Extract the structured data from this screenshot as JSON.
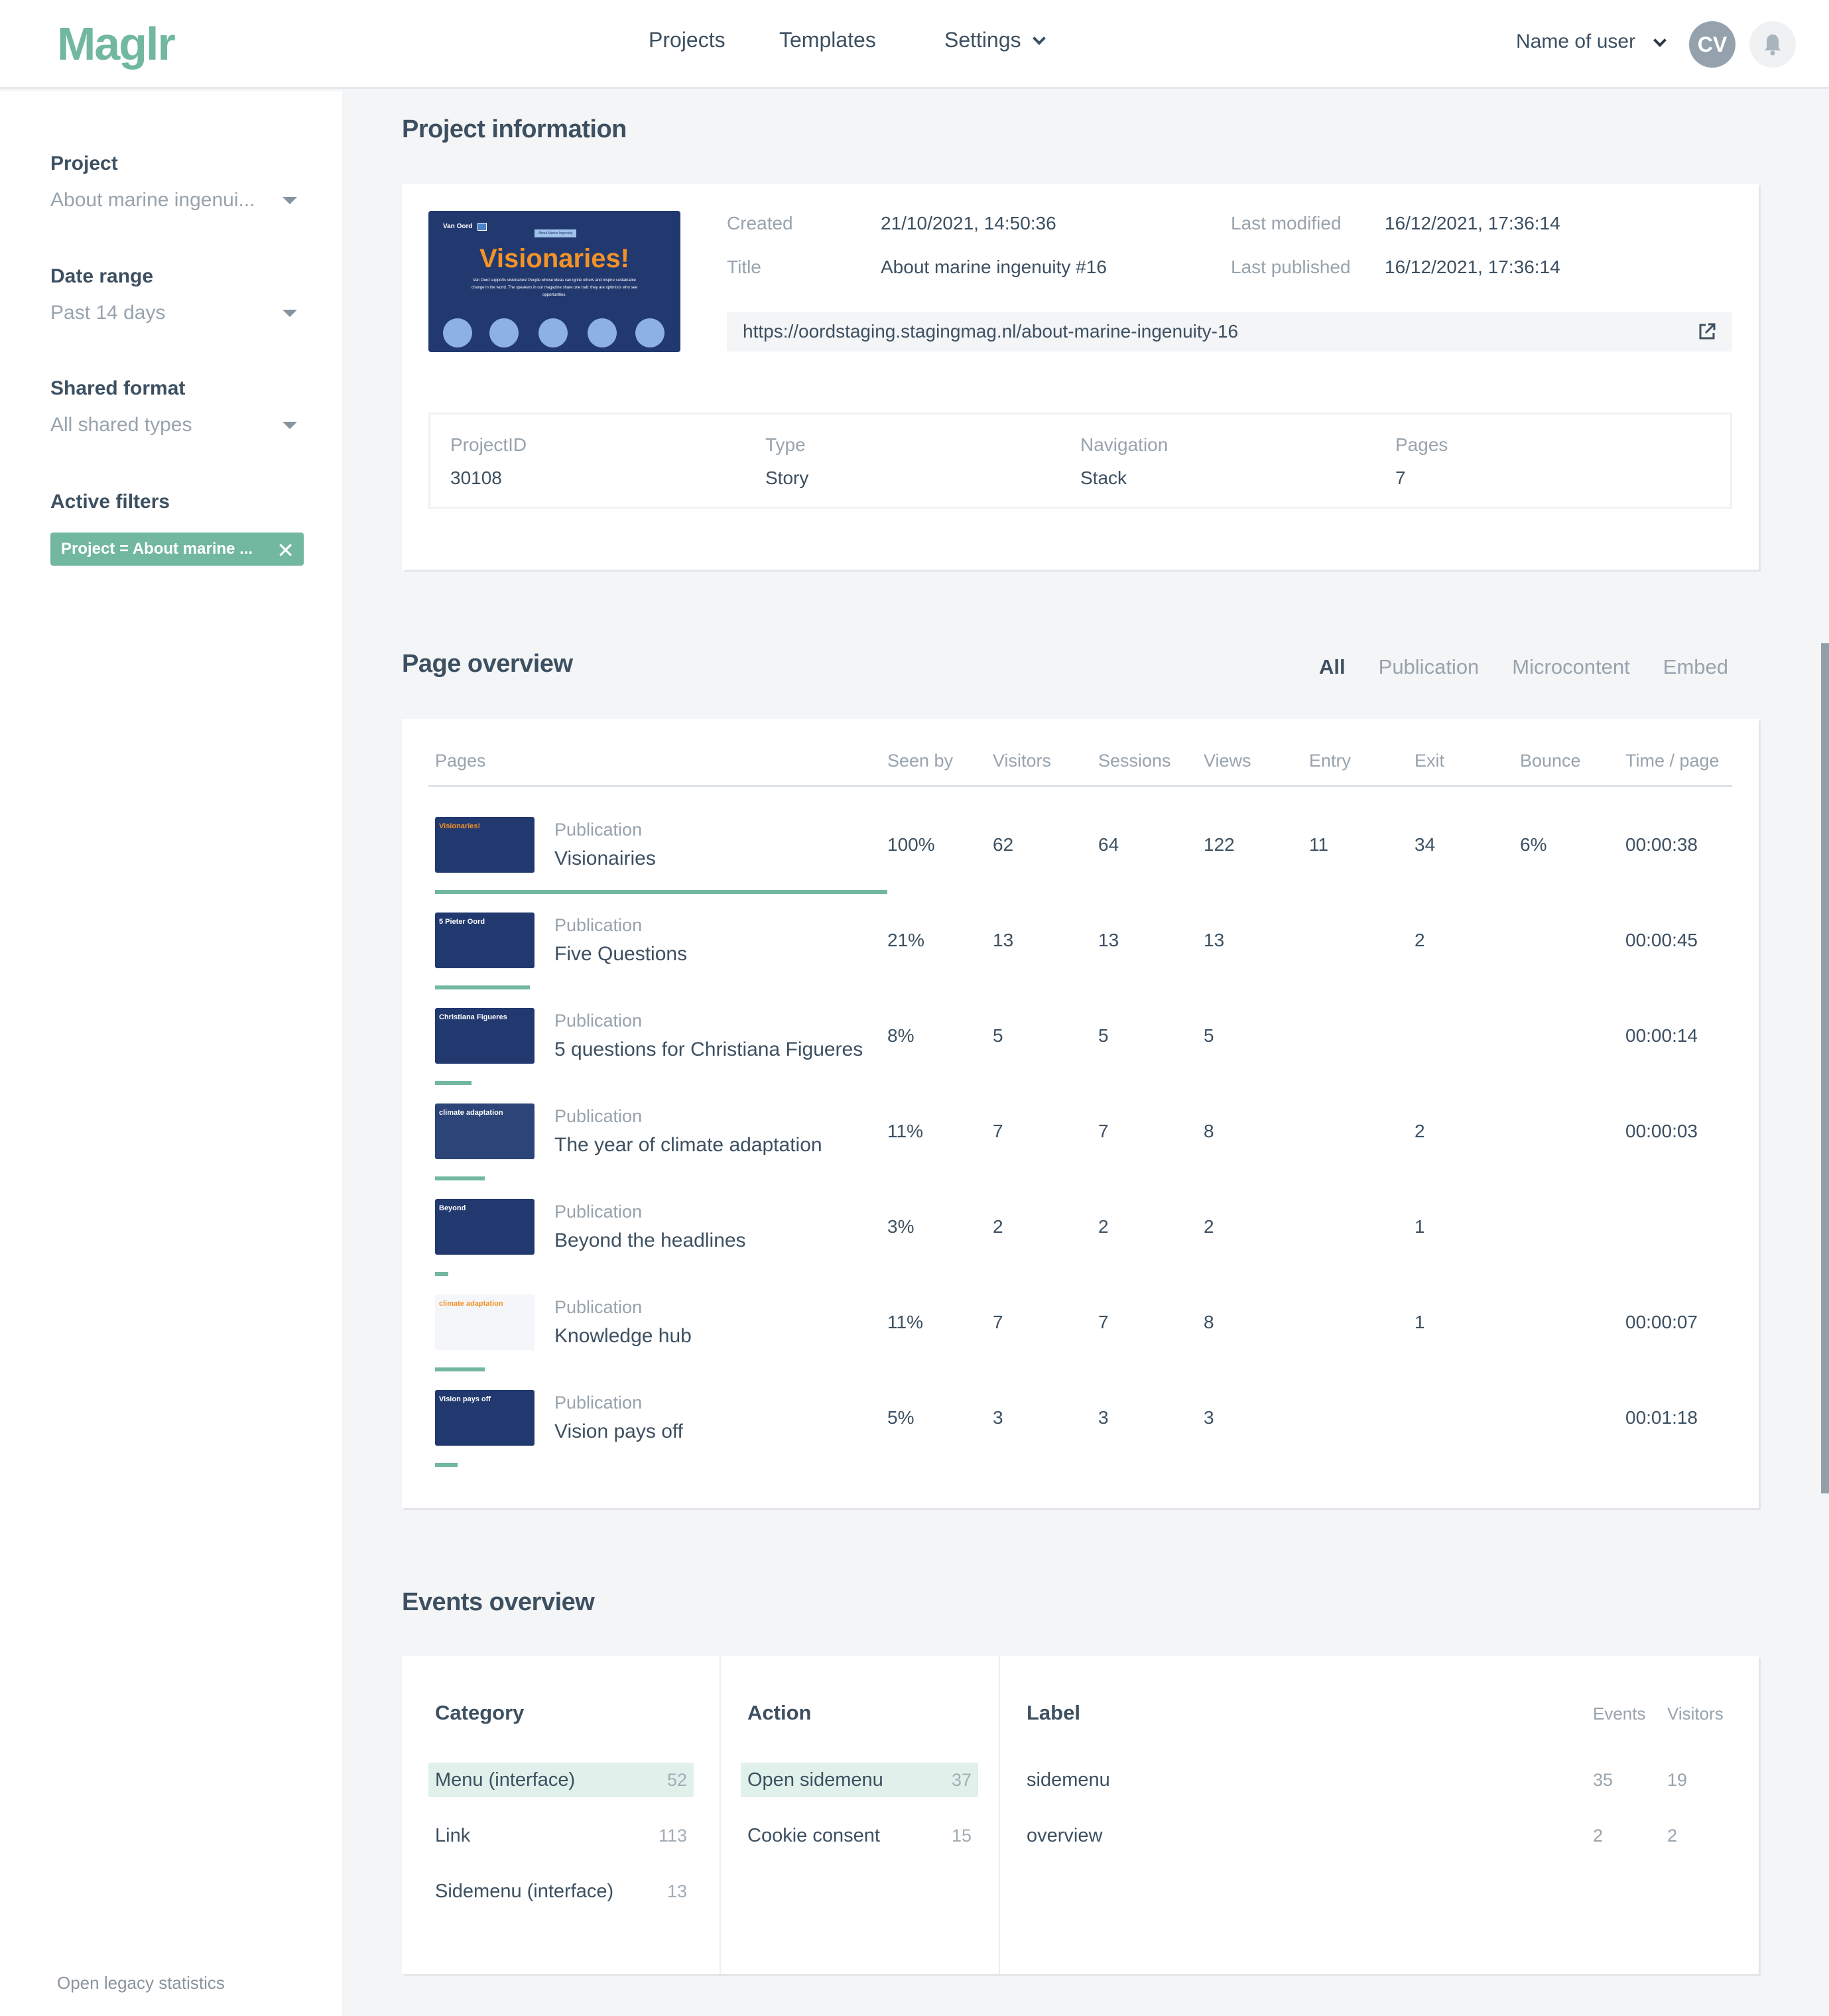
{
  "brand": {
    "logo": "Maglr",
    "accent_color": "#72b7a0"
  },
  "nav": {
    "items": [
      "Projects",
      "Templates",
      "Settings"
    ],
    "user_name": "Name of user",
    "avatar_initials": "CV",
    "bell_icon": "bell-icon"
  },
  "sidebar": {
    "filters": [
      {
        "label": "Project",
        "value": "About marine ingenui..."
      },
      {
        "label": "Date range",
        "value": "Past 14 days"
      },
      {
        "label": "Shared format",
        "value": "All shared types"
      }
    ],
    "active_filters_label": "Active filters",
    "active_filter_chip": "Project = About marine ...",
    "legacy_link": "Open legacy statistics"
  },
  "project_info": {
    "title": "Project information",
    "thumbnail": {
      "brand": "Van Oord",
      "tagline": "Marine ingenuity",
      "badge": "About Marine Ingenuity",
      "headline": "Visionaries!",
      "body": "Van Oord supports visionaries! People whose ideas can ignite others and inspire sustainable change in the world. The speakers in our magazine share one trait: they are optimists who see opportunities."
    },
    "created_label": "Created",
    "created": "21/10/2021, 14:50:36",
    "title_label": "Title",
    "project_title": "About marine ingenuity #16",
    "last_modified_label": "Last modified",
    "last_modified": "16/12/2021, 17:36:14",
    "last_published_label": "Last published",
    "last_published": "16/12/2021, 17:36:14",
    "url": "https://oordstaging.stagingmag.nl/about-marine-ingenuity-16",
    "meta": [
      {
        "label": "ProjectID",
        "value": "30108"
      },
      {
        "label": "Type",
        "value": "Story"
      },
      {
        "label": "Navigation",
        "value": "Stack"
      },
      {
        "label": "Pages",
        "value": "7"
      }
    ]
  },
  "page_overview": {
    "title": "Page overview",
    "tabs": [
      {
        "label": "All",
        "active": true
      },
      {
        "label": "Publication",
        "active": false
      },
      {
        "label": "Microcontent",
        "active": false
      },
      {
        "label": "Embed",
        "active": false
      }
    ],
    "columns": [
      "Pages",
      "Seen by",
      "Visitors",
      "Sessions",
      "Views",
      "Entry",
      "Exit",
      "Bounce",
      "Time / page"
    ],
    "rows": [
      {
        "type": "Publication",
        "name": "Visionairies",
        "seen_by": "100%",
        "seen_fraction": 1.0,
        "visitors": "62",
        "sessions": "64",
        "views": "122",
        "entry": "11",
        "exit": "34",
        "bounce": "6%",
        "time": "00:00:38",
        "thumb_text": "Visionaries!"
      },
      {
        "type": "Publication",
        "name": "Five Questions",
        "seen_by": "21%",
        "seen_fraction": 0.21,
        "visitors": "13",
        "sessions": "13",
        "views": "13",
        "entry": "",
        "exit": "2",
        "bounce": "",
        "time": "00:00:45",
        "thumb_text": "5 Pieter Oord"
      },
      {
        "type": "Publication",
        "name": "5 questions for Christiana Figueres",
        "seen_by": "8%",
        "seen_fraction": 0.08,
        "visitors": "5",
        "sessions": "5",
        "views": "5",
        "entry": "",
        "exit": "",
        "bounce": "",
        "time": "00:00:14",
        "thumb_text": "Christiana Figueres"
      },
      {
        "type": "Publication",
        "name": "The year of climate adaptation",
        "seen_by": "11%",
        "seen_fraction": 0.11,
        "visitors": "7",
        "sessions": "7",
        "views": "8",
        "entry": "",
        "exit": "2",
        "bounce": "",
        "time": "00:00:03",
        "thumb_text": "climate adaptation"
      },
      {
        "type": "Publication",
        "name": "Beyond the headlines",
        "seen_by": "3%",
        "seen_fraction": 0.03,
        "visitors": "2",
        "sessions": "2",
        "views": "2",
        "entry": "",
        "exit": "1",
        "bounce": "",
        "time": "",
        "thumb_text": "Beyond"
      },
      {
        "type": "Publication",
        "name": "Knowledge hub",
        "seen_by": "11%",
        "seen_fraction": 0.11,
        "visitors": "7",
        "sessions": "7",
        "views": "8",
        "entry": "",
        "exit": "1",
        "bounce": "",
        "time": "00:00:07",
        "thumb_text": "climate adaptation"
      },
      {
        "type": "Publication",
        "name": "Vision pays off",
        "seen_by": "5%",
        "seen_fraction": 0.05,
        "visitors": "3",
        "sessions": "3",
        "views": "3",
        "entry": "",
        "exit": "",
        "bounce": "",
        "time": "00:01:18",
        "thumb_text": "Vision pays off"
      }
    ]
  },
  "events": {
    "title": "Events overview",
    "category_header": "Category",
    "categories": [
      {
        "label": "Menu (interface)",
        "count": "52",
        "selected": true
      },
      {
        "label": "Link",
        "count": "113",
        "selected": false
      },
      {
        "label": "Sidemenu (interface)",
        "count": "13",
        "selected": false
      }
    ],
    "action_header": "Action",
    "actions": [
      {
        "label": "Open sidemenu",
        "count": "37",
        "selected": true
      },
      {
        "label": "Cookie consent",
        "count": "15",
        "selected": false
      }
    ],
    "label_header": "Label",
    "events_col": "Events",
    "visitors_col": "Visitors",
    "labels": [
      {
        "label": "sidemenu",
        "events": "35",
        "visitors": "19"
      },
      {
        "label": "overview",
        "events": "2",
        "visitors": "2"
      }
    ]
  }
}
